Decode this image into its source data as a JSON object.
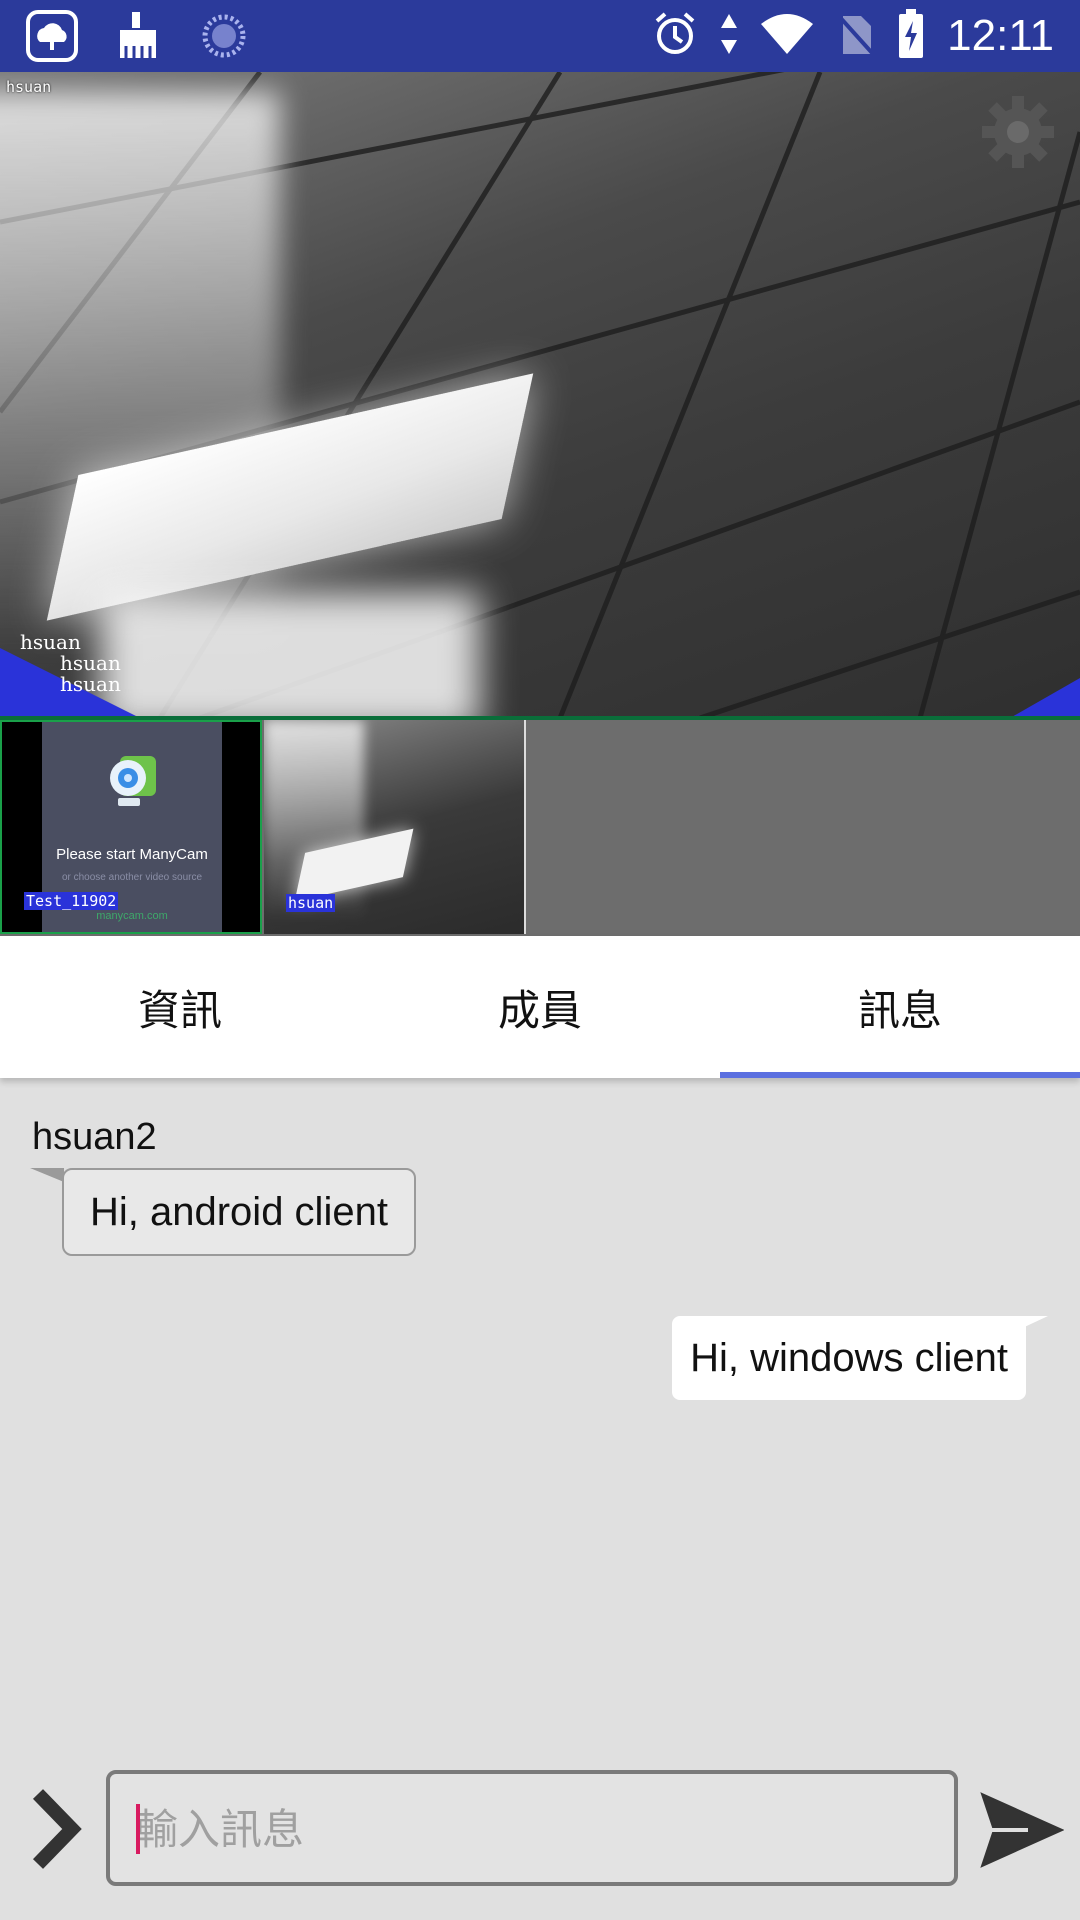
{
  "status_bar": {
    "left_icons": [
      "cloud-app-icon",
      "cleaner-icon",
      "loading-icon"
    ],
    "right_icons": [
      "alarm-icon",
      "data-arrows-icon",
      "wifi-icon",
      "no-sim-icon",
      "battery-charging-icon"
    ],
    "time": "12:11"
  },
  "main_video": {
    "top_label": "hsuan",
    "overlay_names": [
      "hsuan",
      "hsuan",
      "hsuan"
    ],
    "settings_icon": "gear-icon"
  },
  "thumbnails": [
    {
      "label": "Test_11902",
      "title": "Please start ManyCam",
      "subtitle": "or choose another video source",
      "url": "manycam.com"
    },
    {
      "label": "hsuan"
    }
  ],
  "tabs": [
    {
      "label": "資訊",
      "active": false
    },
    {
      "label": "成員",
      "active": false
    },
    {
      "label": "訊息",
      "active": true
    }
  ],
  "chat": {
    "messages": [
      {
        "sender": "hsuan2",
        "text": "Hi, android client",
        "direction": "in"
      },
      {
        "text": "Hi, windows client",
        "direction": "out"
      }
    ]
  },
  "input": {
    "placeholder": "輸入訊息",
    "value": ""
  },
  "colors": {
    "status_bar": "#2b3a9b",
    "tab_indicator": "#5b6fe0",
    "caret": "#d81b60"
  }
}
